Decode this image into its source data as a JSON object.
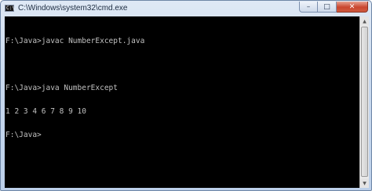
{
  "window": {
    "title": "C:\\Windows\\system32\\cmd.exe",
    "icon_text": "C:\\",
    "controls": {
      "minimize_glyph": "–",
      "maximize_glyph": "□",
      "close_glyph": "✕"
    }
  },
  "console": {
    "lines": [
      "F:\\Java>javac NumberExcept.java",
      "",
      "F:\\Java>java NumberExcept",
      "1 2 3 4 6 7 8 9 10",
      "F:\\Java>"
    ]
  },
  "scrollbar": {
    "up_glyph": "▲",
    "down_glyph": "▼"
  },
  "colors": {
    "console_background": "#000000",
    "console_text": "#c0c0c0",
    "close_button": "#c9472f"
  }
}
